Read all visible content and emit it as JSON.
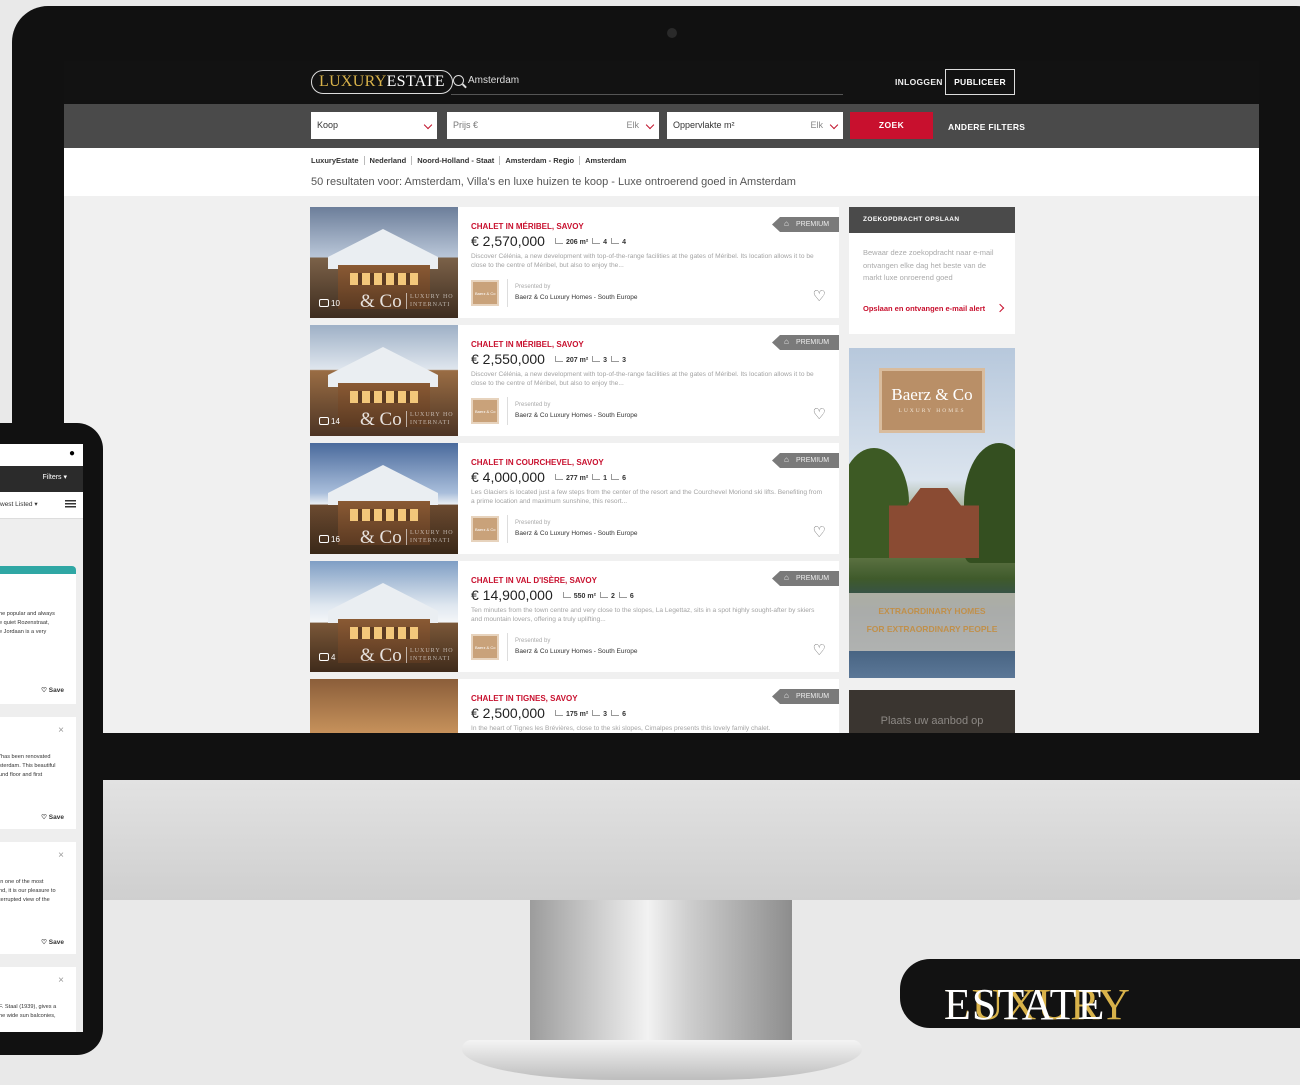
{
  "header": {
    "logo_part1": "LUXURY",
    "logo_part2": "ESTATE",
    "search_value": "Amsterdam",
    "login": "INLOGGEN",
    "publish": "PUBLICEER"
  },
  "filters": {
    "type": "Koop",
    "price_placeholder": "Prijs €",
    "price_any": "Elk",
    "area_placeholder": "Oppervlakte m²",
    "area_any": "Elk",
    "search_button": "ZOEK",
    "more_filters": "ANDERE FILTERS"
  },
  "breadcrumb": [
    "LuxuryEstate",
    "Nederland",
    "Noord-Holland - Staat",
    "Amsterdam - Regio",
    "Amsterdam"
  ],
  "results_text": "50 resultaten voor: Amsterdam, Villa's en luxe huizen te koop - Luxe ontroerend goed in Amsterdam",
  "badge_label": "PREMIUM",
  "presented_by": "Presented by",
  "agency": "Baerz & Co Luxury Homes - South Europe",
  "watermark": "& Co",
  "watermark_small": "LUXURY HO INTERNATI",
  "listings": [
    {
      "title": "CHALET IN MÉRIBEL, SAVOY",
      "price": "€ 2,570,000",
      "area": "206 m²",
      "beds": "4",
      "baths": "4",
      "photos": "10",
      "desc": "Discover Célénia, a new development with top-of-the-range facilities at the gates of Méribel. Its location allows it to be close to the centre of Méribel, but also to enjoy the..."
    },
    {
      "title": "CHALET IN MÉRIBEL, SAVOY",
      "price": "€ 2,550,000",
      "area": "207 m²",
      "beds": "3",
      "baths": "3",
      "photos": "14",
      "desc": "Discover Célénia, a new development with top-of-the-range facilities at the gates of Méribel. Its location allows it to be close to the centre of Méribel, but also to enjoy the..."
    },
    {
      "title": "CHALET IN COURCHEVEL, SAVOY",
      "price": "€ 4,000,000",
      "area": "277 m²",
      "beds": "1",
      "baths": "6",
      "photos": "16",
      "desc": "Les Glaciers is located just a few steps from the center of the resort and the Courchevel Moriond ski lifts. Benefiting from a prime location and maximum sunshine, this resort..."
    },
    {
      "title": "CHALET IN VAL D'ISÈRE, SAVOY",
      "price": "€ 14,900,000",
      "area": "550 m²",
      "beds": "2",
      "baths": "6",
      "photos": "4",
      "desc": "Ten minutes from the town centre and very close to the slopes, La Legettaz, sits in a spot highly sought-after by skiers and mountain lovers, offering a truly uplifting..."
    },
    {
      "title": "CHALET IN TIGNES, SAVOY",
      "price": "€ 2,500,000",
      "area": "175 m²",
      "beds": "3",
      "baths": "6",
      "photos": "",
      "desc": "In the heart of Tignes les Brévières, close to the ski slopes, Cimalpes presents this lovely family chalet."
    }
  ],
  "sidebar": {
    "save_title": "ZOEKOPDRACHT OPSLAAN",
    "save_text": "Bewaar deze zoekopdracht naar e-mail ontvangen elke dag het beste van de markt luxe onroerend goed",
    "save_link": "Opslaan en ontvangen e-mail alert",
    "ad_brand": "Baerz & Co",
    "ad_brand_sub": "LUXURY HOMES",
    "ad_line1": "EXTRAORDINARY HOMES",
    "ad_line2": "FOR EXTRAORDINARY PEOPLE",
    "ad2_text": "Plaats uw aanbod op"
  },
  "phone": {
    "filters": "Filters ▾",
    "sort": "west Listed ▾",
    "save": "♡ Save",
    "texts": [
      "he popular and always\ne quiet Rozenstraat,\ne Jordaan is a very",
      "\"has been renovated\nsterdam. This beautiful\nund floor and first",
      "in one of the most\nnd, it is our pleasure to\nterrupted view of the",
      "F. Staal (1939), gives a\nhe wide sun balconies,"
    ]
  },
  "brand_tag": {
    "part1": "LUXURY",
    "part2": "ESTATE"
  }
}
